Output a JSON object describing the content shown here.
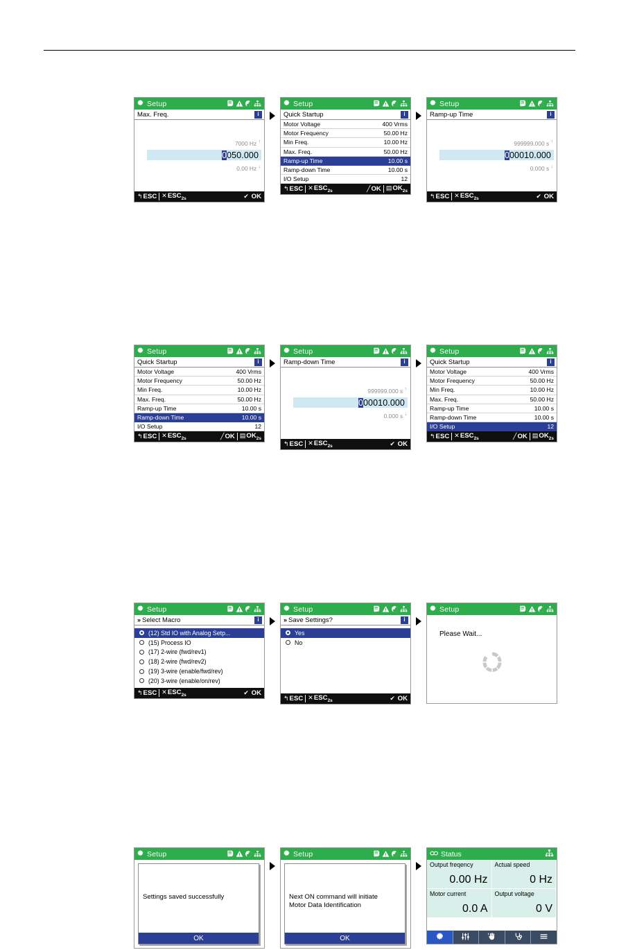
{
  "page": {
    "has_top_rule": true
  },
  "colors": {
    "header_green": "#2dad4b",
    "select_blue": "#2b3f97",
    "field_blue": "#cfe8f2",
    "footer_black": "#0f0f0f",
    "status_cell": "#d9efe9",
    "status_bar": "#3b4a63",
    "status_tab_active": "#2b57c4"
  },
  "common": {
    "title_setup": "Setup",
    "info_badge": "i",
    "chevron": "»",
    "footer": {
      "esc": "ESC",
      "esc2s": "ESC",
      "esc2s_sub": "2s",
      "ok": "OK",
      "ok2s": "OK",
      "ok2s_sub": "2s",
      "check_glyph": "✔",
      "back_glyph": "↰",
      "x_glyph": "✕",
      "pencil_glyph": "╱",
      "save_glyph": "▤"
    },
    "header_icons": [
      "document-a-icon",
      "warning-triangle-icon",
      "globe-icon",
      "network-icon"
    ]
  },
  "screens": [
    {
      "id": "max-freq-edit",
      "title": "Setup",
      "subtitle": "Max. Freq.",
      "type": "value-edit",
      "max_value": "7000 Hz",
      "max_symbol": "↑",
      "min_value": "0.00 Hz",
      "min_symbol": "↓",
      "cursor_digit": "0",
      "rest_digits": "050.000",
      "footer_right": "ok"
    },
    {
      "id": "quick-startup-rampup",
      "title": "Setup",
      "subtitle": "Quick Startup",
      "type": "list",
      "rows": [
        {
          "label": "Motor Voltage",
          "value": "400 Vrms",
          "selected": false
        },
        {
          "label": "Motor Frequency",
          "value": "50.00 Hz",
          "selected": false
        },
        {
          "label": "Min Freq.",
          "value": "10.00 Hz",
          "selected": false
        },
        {
          "label": "Max. Freq.",
          "value": "50.00 Hz",
          "selected": false
        },
        {
          "label": "Ramp-up Time",
          "value": "10.00 s",
          "selected": true
        },
        {
          "label": "Ramp-down Time",
          "value": "10.00 s",
          "selected": false
        },
        {
          "label": "I/O Setup",
          "value": "12",
          "selected": false
        }
      ],
      "footer_right": "edit-save"
    },
    {
      "id": "ramp-up-time-edit",
      "title": "Setup",
      "subtitle": "Ramp-up Time",
      "type": "value-edit",
      "max_value": "999999.000 s",
      "max_symbol": "↑",
      "min_value": "0.000 s",
      "min_symbol": "↓",
      "cursor_digit": "0",
      "rest_digits": "00010.000",
      "footer_right": "ok"
    },
    {
      "id": "quick-startup-rampdown",
      "title": "Setup",
      "subtitle": "Quick Startup",
      "type": "list",
      "rows": [
        {
          "label": "Motor Voltage",
          "value": "400 Vrms",
          "selected": false
        },
        {
          "label": "Motor Frequency",
          "value": "50.00 Hz",
          "selected": false
        },
        {
          "label": "Min Freq.",
          "value": "10.00 Hz",
          "selected": false
        },
        {
          "label": "Max. Freq.",
          "value": "50.00 Hz",
          "selected": false
        },
        {
          "label": "Ramp-up Time",
          "value": "10.00 s",
          "selected": false
        },
        {
          "label": "Ramp-down Time",
          "value": "10.00 s",
          "selected": true
        },
        {
          "label": "I/O Setup",
          "value": "12",
          "selected": false
        }
      ],
      "footer_right": "edit-save"
    },
    {
      "id": "ramp-down-time-edit",
      "title": "Setup",
      "subtitle": "Ramp-down Time",
      "type": "value-edit",
      "max_value": "999999.000 s",
      "max_symbol": "↑",
      "min_value": "0.000 s",
      "min_symbol": "↓",
      "cursor_digit": "0",
      "rest_digits": "00010.000",
      "footer_right": "ok"
    },
    {
      "id": "quick-startup-iosetup",
      "title": "Setup",
      "subtitle": "Quick Startup",
      "type": "list",
      "rows": [
        {
          "label": "Motor Voltage",
          "value": "400 Vrms",
          "selected": false
        },
        {
          "label": "Motor Frequency",
          "value": "50.00 Hz",
          "selected": false
        },
        {
          "label": "Min Freq.",
          "value": "10.00 Hz",
          "selected": false
        },
        {
          "label": "Max. Freq.",
          "value": "50.00 Hz",
          "selected": false
        },
        {
          "label": "Ramp-up Time",
          "value": "10.00 s",
          "selected": false
        },
        {
          "label": "Ramp-down Time",
          "value": "10.00 s",
          "selected": false
        },
        {
          "label": "I/O Setup",
          "value": "12",
          "selected": true
        }
      ],
      "footer_right": "edit-save"
    },
    {
      "id": "select-macro",
      "title": "Setup",
      "subtitle": "Select Macro",
      "type": "radio-list",
      "options": [
        {
          "label": "(12) Std IO with Analog Setp...",
          "selected": true
        },
        {
          "label": "(15) Process IO",
          "selected": false
        },
        {
          "label": "(17) 2-wire (fwd/rev1)",
          "selected": false
        },
        {
          "label": "(18) 2-wire (fwd/rev2)",
          "selected": false
        },
        {
          "label": "(19) 3-wire (enable/fwd/rev)",
          "selected": false
        },
        {
          "label": "(20) 3-wire (enable/on/rev)",
          "selected": false
        }
      ],
      "footer_right": "ok"
    },
    {
      "id": "save-settings",
      "title": "Setup",
      "subtitle": "Save Settings?",
      "type": "radio-list",
      "options": [
        {
          "label": "Yes",
          "selected": true
        },
        {
          "label": "No",
          "selected": false
        }
      ],
      "footer_right": "ok"
    },
    {
      "id": "please-wait",
      "title": "Setup",
      "type": "wait",
      "message": "Please Wait..."
    },
    {
      "id": "settings-saved",
      "title": "Setup",
      "type": "dialog",
      "lines": [
        "Settings saved successfully"
      ],
      "button": "OK"
    },
    {
      "id": "motor-data-identification",
      "title": "Setup",
      "type": "dialog",
      "lines": [
        "Next ON command will initiate",
        "Motor Data Identification"
      ],
      "button": "OK"
    },
    {
      "id": "status",
      "title": "Status",
      "type": "status",
      "cells": [
        {
          "label": "Output freqency",
          "value": "0.00 Hz"
        },
        {
          "label": "Actual speed",
          "value": "0 Hz"
        },
        {
          "label": "Motor current",
          "value": "0.0 A"
        },
        {
          "label": "Output voltage",
          "value": "0 V"
        }
      ],
      "tabs": [
        {
          "icon": "gear-icon",
          "active": true
        },
        {
          "icon": "sliders-icon",
          "active": false
        },
        {
          "icon": "hand-icon",
          "active": false
        },
        {
          "icon": "stethoscope-icon",
          "active": false
        },
        {
          "icon": "menu-icon",
          "active": false
        }
      ]
    }
  ]
}
